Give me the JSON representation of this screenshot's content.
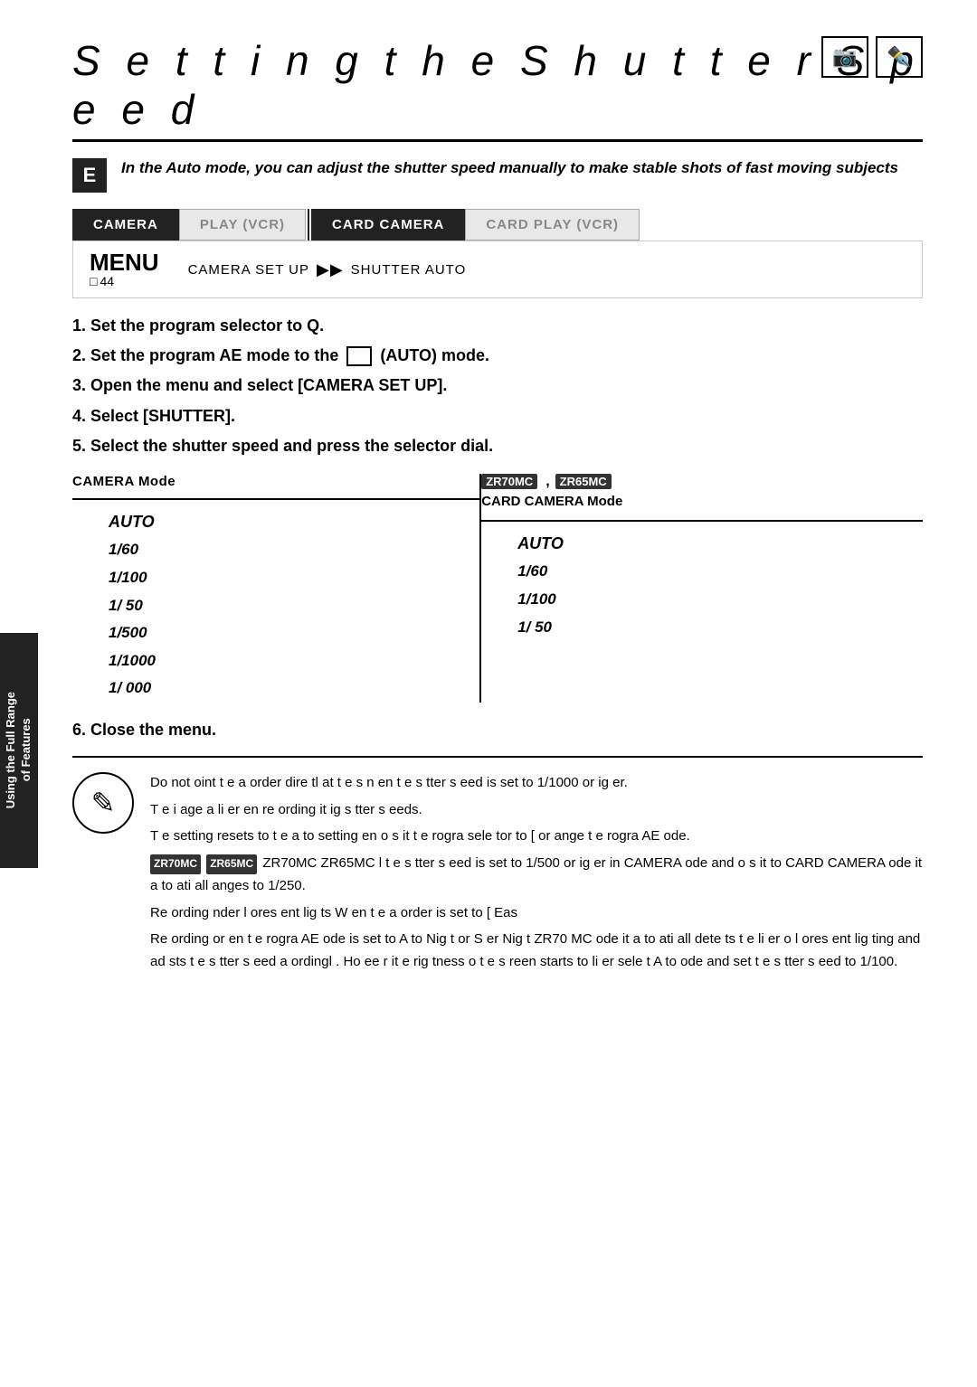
{
  "page": {
    "title": "S e t t i n g   t h e   S h u t t e r   S p e e d"
  },
  "top_icons": [
    {
      "name": "camera-icon",
      "symbol": "📷"
    },
    {
      "name": "pen-icon",
      "symbol": "✏️"
    }
  ],
  "letter_badge": "E",
  "intro": {
    "text": "In the   Auto mode, you can adjust the shutter speed manually to make stable shots of fast moving subjects"
  },
  "nav_tabs": [
    {
      "label": "CAMERA",
      "state": "active"
    },
    {
      "label": "PLAY (VCR)",
      "state": "inactive"
    },
    {
      "label": "CARD CAMERA",
      "state": "active"
    },
    {
      "label": "CARD PLAY (VCR)",
      "state": "inactive"
    }
  ],
  "menu": {
    "label": "MENU",
    "page": "44",
    "path_start": "CAMERA SET UP",
    "arrow": "▶▶",
    "path_end": "SHUTTER   AUTO"
  },
  "steps": [
    "1. Set the program selector to Q.",
    "2. Set the program AE mode to the      (AUTO) mode.",
    "3. Open the menu and select [CAMERA SET UP].",
    "4. Select [SHUTTER].",
    "5. Select the shutter speed and press the selector dial."
  ],
  "shutter_table": {
    "left_header": "CAMERA Mode",
    "right_model1": "ZR70MC",
    "right_model2": "ZR65MC",
    "right_header": "CARD CAMERA Mode",
    "left_speeds": [
      "AUTO",
      "1/60",
      "1/100",
      "1/ 50",
      "1/500",
      "1/1000",
      "1/ 000"
    ],
    "right_speeds": [
      "AUTO",
      "1/60",
      "1/100",
      "1/ 50"
    ]
  },
  "step6": "6. Close the menu.",
  "side_tab": {
    "line1": "Using the Full Range",
    "line2": "of Features"
  },
  "note": {
    "paragraphs": [
      "Do not  oint t e a   order dire tl  at t e s n   en t e s  tter s eed is set to 1/1000 or  ig er.",
      "T e i age  a  li er   en re ording  it  ig s  tter s eeds.",
      "T e setting resets to t  e a  to setting   en o s  it  t e rogra   sele tor to [   or   ange t e  rogra   AE  ode.",
      "ZR70MC  ZR65MC  l t e s  tter s eed is set to 1/500 or  ig er in CAMERA  ode and o s  it   to CARD CAMERA  ode it a to  ati all   anges to 1/250.",
      "Re ording  nder l ores ent lig ts W en t e a  order is set to [   Eas",
      "Re ording or   en t e rogra   AE  ode is set to A to  Nig t or S  er Nig t  ZR70 MC   ode it a to  ati all  dete ts t e li  er o  l ores ent lig ting and ad  sts t e s  tter s eed a  ordingl . Ho  ee r it e  rig tness o  t e s reen starts to  li  er sele t A to  ode and set t e s  tter s eed to 1/100."
    ]
  }
}
